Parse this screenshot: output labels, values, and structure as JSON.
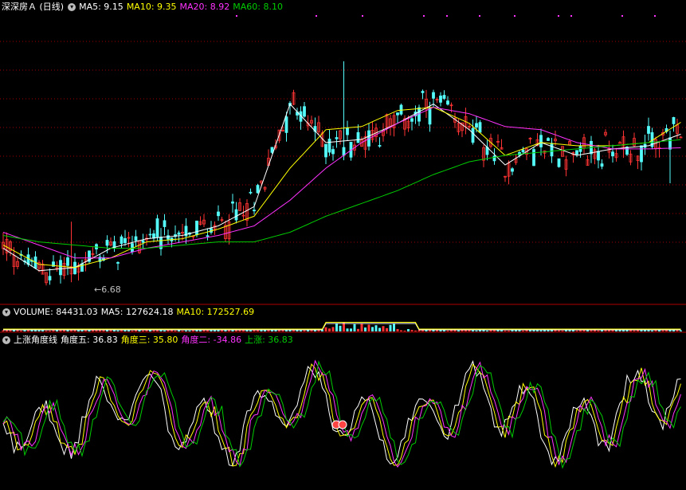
{
  "colors": {
    "up": "#ff3333",
    "down": "#54fcfc",
    "ma5": "#ffffff",
    "ma10": "#ffff00",
    "ma20": "#ff33ff",
    "ma60": "#00cc00",
    "grid": "#a00000",
    "label": "#c0c0c0"
  },
  "price_header": {
    "title": "深深房Ａ (日线)",
    "ma5": "MA5: 9.15",
    "ma10": "MA10: 9.35",
    "ma20": "MA20: 8.92",
    "ma60": "MA60: 8.10"
  },
  "low_marker": "6.68",
  "volume_header": {
    "title": "VOLUME: 84431.03",
    "ma5": "MA5: 127624.18",
    "ma10": "MA10: 172527.69"
  },
  "indicator_header": {
    "title": "上涨角度线",
    "a5": "角度五: 36.83",
    "a3": "角度三: 35.80",
    "a2": "角度二: -34.86",
    "up": "上涨: 36.83"
  },
  "chart_data": [
    {
      "type": "candlestick",
      "title": "深深房Ａ (日线)",
      "series": [
        {
          "name": "MA5",
          "x": [
            0,
            10,
            20,
            30,
            40,
            50,
            60,
            70,
            80,
            90,
            100,
            110,
            120,
            130,
            140,
            150,
            160,
            170,
            180,
            190
          ],
          "y": [
            7.35,
            7.0,
            7.05,
            7.35,
            7.5,
            7.55,
            7.7,
            8.0,
            9.6,
            9.0,
            9.05,
            9.3,
            9.6,
            9.2,
            8.65,
            9.0,
            8.8,
            8.9,
            8.95,
            9.15
          ]
        },
        {
          "name": "MA10",
          "x": [
            0,
            10,
            20,
            30,
            40,
            50,
            60,
            70,
            80,
            90,
            100,
            110,
            120,
            130,
            140,
            150,
            160,
            170,
            180,
            190
          ],
          "y": [
            7.4,
            7.1,
            7.05,
            7.2,
            7.45,
            7.5,
            7.65,
            7.85,
            8.6,
            9.2,
            9.25,
            9.5,
            9.55,
            9.3,
            8.8,
            9.0,
            8.95,
            8.95,
            9.0,
            9.35
          ]
        },
        {
          "name": "MA20",
          "x": [
            0,
            10,
            20,
            30,
            40,
            50,
            60,
            70,
            80,
            90,
            100,
            110,
            120,
            130,
            140,
            150,
            160,
            170,
            180,
            190
          ],
          "y": [
            7.6,
            7.4,
            7.2,
            7.2,
            7.35,
            7.45,
            7.55,
            7.7,
            8.1,
            8.6,
            9.0,
            9.3,
            9.55,
            9.45,
            9.25,
            9.2,
            9.0,
            8.9,
            8.9,
            8.92
          ]
        },
        {
          "name": "MA60",
          "x": [
            0,
            10,
            20,
            30,
            40,
            50,
            60,
            70,
            80,
            90,
            100,
            110,
            120,
            130,
            140,
            150,
            160,
            170,
            180,
            190
          ],
          "y": [
            7.55,
            7.45,
            7.4,
            7.35,
            7.35,
            7.4,
            7.45,
            7.45,
            7.6,
            7.85,
            8.05,
            8.25,
            8.5,
            8.7,
            8.8,
            8.85,
            8.9,
            8.95,
            9.0,
            9.05
          ]
        }
      ],
      "low_label": "6.68"
    },
    {
      "type": "bar",
      "title": "VOLUME: 84431.03",
      "series": [
        {
          "name": "MA5",
          "values": [
            127624.18
          ]
        },
        {
          "name": "MA10",
          "values": [
            172527.69
          ]
        }
      ]
    },
    {
      "type": "line",
      "title": "上涨角度线",
      "series": [
        {
          "name": "角度五",
          "values": [
            36.83
          ]
        },
        {
          "name": "角度三",
          "values": [
            35.8
          ]
        },
        {
          "name": "角度二",
          "values": [
            -34.86
          ]
        },
        {
          "name": "上涨",
          "values": [
            36.83
          ]
        }
      ]
    }
  ]
}
